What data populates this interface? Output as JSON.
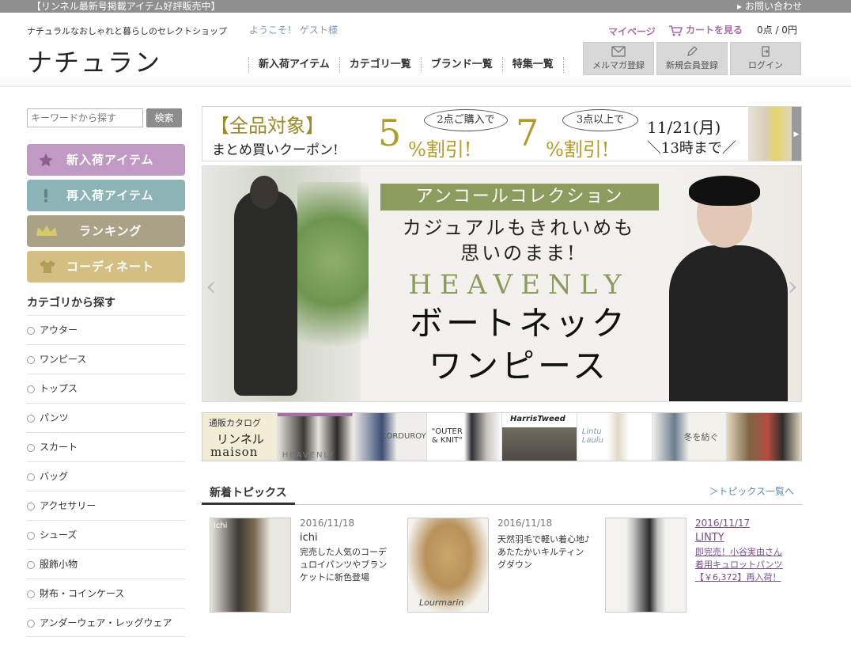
{
  "topbar": {
    "notice": "【リンネル最新号掲載アイテム好評販売中】",
    "contact": "▸ お問い合わせ"
  },
  "header": {
    "tagline": "ナチュラルなおしゃれと暮らしのセレクトショップ",
    "logo": "ナチュラン",
    "welcome": "ようこそ！ ゲスト様",
    "mypage": "マイページ",
    "cart": "カートを見る",
    "cart_summary": "0点 / 0円",
    "nav": [
      "新入荷アイテム",
      "カテゴリ一覧",
      "ブランド一覧",
      "特集一覧"
    ],
    "buttons": [
      "メルマガ登録",
      "新規会員登録",
      "ログイン"
    ]
  },
  "sidebar": {
    "search_placeholder": "キーワードから探す",
    "search_button": "検索",
    "menu": [
      "新入荷アイテム",
      "再入荷アイテム",
      "ランキング",
      "コーディネート"
    ],
    "category_heading": "カテゴリから探す",
    "categories": [
      "アウター",
      "ワンピース",
      "トップス",
      "パンツ",
      "スカート",
      "バッグ",
      "アクセサリー",
      "シューズ",
      "服飾小物",
      "財布・コインケース",
      "アンダーウェア・レッグウェア"
    ]
  },
  "coupon": {
    "line1": "【全品対象】",
    "line2": "まとめ買いクーポン!",
    "bubble1": "2点ご購入で",
    "pct1": "5",
    "off1": "%割引!",
    "bubble2": "3点以上で",
    "pct2": "7",
    "off2": "%割引!",
    "date": "11/21(月)",
    "until": "＼13時まで／"
  },
  "hero": {
    "tag": "アンコールコレクション",
    "line1": "カジュアルもきれいめも",
    "line2": "思いのまま!",
    "brand": "HEAVENLY",
    "product1": "ボートネック",
    "product2": "ワンピース"
  },
  "thumbs": {
    "catalog_a": "通販カタログ",
    "catalog_b": "リンネル",
    "catalog_c": "maison",
    "heavenly": "HEAVENLY",
    "corduroy": "CORDUROY",
    "outer": "\"OUTER & KNIT\"",
    "harris": "HarrisTweed",
    "lintu": "Lintu Laulu",
    "fuyu": "冬を紡ぐ"
  },
  "topics": {
    "heading": "新着トピックス",
    "more": "＞トピックス一覧へ",
    "items": [
      {
        "date": "2016/11/18",
        "title": "ichi",
        "desc": "完売した人気のコーデュロイパンツやブランケットに新色登場",
        "img_label": "ichi"
      },
      {
        "date": "2016/11/18",
        "title": "",
        "desc": "天然羽毛で軽い着心地♪あたたかいキルティングダウン",
        "img_label": "Lourmarin"
      },
      {
        "date": "2016/11/17",
        "title": "LINTY",
        "desc": "即完売！小谷実由さん着用キュロットパンツ【￥6,372】再入荷！"
      }
    ]
  }
}
